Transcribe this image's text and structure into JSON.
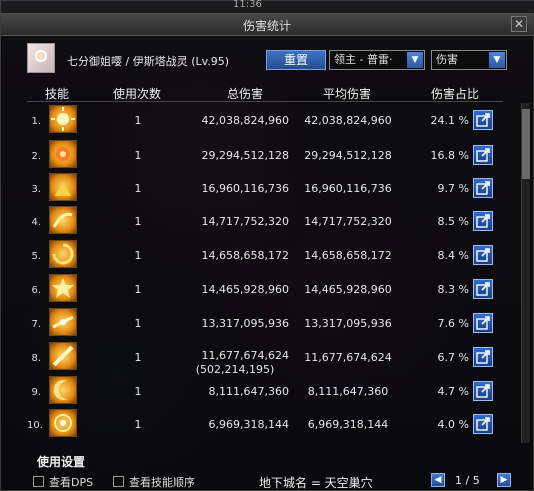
{
  "clock": "11:36",
  "window": {
    "title": "伤害统计",
    "close_label": "✕"
  },
  "header": {
    "character": "七分御姐嘤 / 伊斯塔战灵 (Lv.95)",
    "reset_label": "重置",
    "boss_select": "领主 - 普雷·",
    "type_select": "伤害"
  },
  "columns": {
    "skill": "技能",
    "times": "使用次数",
    "total": "总伤害",
    "average": "平均伤害",
    "share": "伤害占比"
  },
  "rows": [
    {
      "rank": "1.",
      "icon": "sun-burst-icon",
      "times": "1",
      "total": "42,038,824,960",
      "total_extra": "",
      "average": "42,038,824,960",
      "percent": "24.1 %"
    },
    {
      "rank": "2.",
      "icon": "flame-sun-icon",
      "times": "1",
      "total": "29,294,512,128",
      "total_extra": "",
      "average": "29,294,512,128",
      "percent": "16.8 %"
    },
    {
      "rank": "3.",
      "icon": "fire-wave-icon",
      "times": "1",
      "total": "16,960,116,736",
      "total_extra": "",
      "average": "16,960,116,736",
      "percent": "9.7 %"
    },
    {
      "rank": "4.",
      "icon": "slash-arc-icon",
      "times": "1",
      "total": "14,717,752,320",
      "total_extra": "",
      "average": "14,717,752,320",
      "percent": "8.5 %"
    },
    {
      "rank": "5.",
      "icon": "spiral-icon",
      "times": "1",
      "total": "14,658,658,172",
      "total_extra": "",
      "average": "14,658,658,172",
      "percent": "8.4 %"
    },
    {
      "rank": "6.",
      "icon": "star-burst-icon",
      "times": "1",
      "total": "14,465,928,960",
      "total_extra": "",
      "average": "14,465,928,960",
      "percent": "8.3 %"
    },
    {
      "rank": "7.",
      "icon": "radiant-slash-icon",
      "times": "1",
      "total": "13,317,095,936",
      "total_extra": "",
      "average": "13,317,095,936",
      "percent": "7.6 %"
    },
    {
      "rank": "8.",
      "icon": "blade-strike-icon",
      "times": "1",
      "total": "11,677,674,624",
      "total_extra": "(502,214,195)",
      "average": "11,677,674,624",
      "percent": "6.7 %"
    },
    {
      "rank": "9.",
      "icon": "crescent-icon",
      "times": "1",
      "total": "8,111,647,360",
      "total_extra": "",
      "average": "8,111,647,360",
      "percent": "4.7 %"
    },
    {
      "rank": "10.",
      "icon": "vortex-icon",
      "times": "1",
      "total": "6,969,318,144",
      "total_extra": "",
      "average": "6,969,318,144",
      "percent": "4.0 %"
    }
  ],
  "footer": {
    "settings_label": "使用设置",
    "show_dps": "查看DPS",
    "show_order": "查看技能顺序",
    "dungeon": "地下城名 = 天空巢穴",
    "page": "1 / 5",
    "prev_label": "◀",
    "next_label": "▶"
  }
}
